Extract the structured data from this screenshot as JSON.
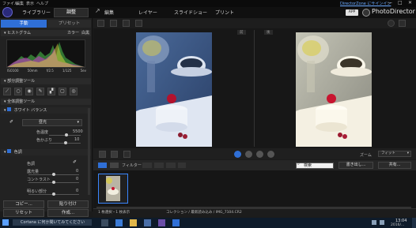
{
  "window": {
    "menus": [
      "ファイル",
      "編集",
      "表示",
      "ヘルプ"
    ],
    "signin_link": "DirectorZone にサインイン",
    "minimize": "—",
    "maximize": "□",
    "close": "✕"
  },
  "nav": {
    "items": [
      "ライブラリー",
      "調整",
      "編集",
      "レイヤー",
      "スライドショー",
      "プリント"
    ],
    "active": "調整",
    "app_badge": "APP",
    "brand": "PhotoDirector"
  },
  "left_panel": {
    "tabs": [
      "手動",
      "プリセット"
    ],
    "histogram": {
      "title": "ヒストグラム",
      "color_label": "カラー",
      "white_label": "白黒",
      "info": [
        "ISO100",
        "50mm",
        "f/2.5",
        "1/125",
        "5ev"
      ]
    },
    "section_partial": "部分調整ツール",
    "section_global": "全体調整ツール",
    "wb": {
      "title": "ホワイト バランス",
      "preset": "昼光",
      "temp_label": "色温度",
      "temp_value": "5500",
      "temp_pct": 0.55,
      "tint_label": "色かぶり",
      "tint_value": "10",
      "tint_pct": 0.52
    },
    "tone": {
      "title": "色調",
      "color_label": "色調",
      "exposure_label": "露光量",
      "contrast_label": "コントラスト",
      "highlight_label": "明るい部分",
      "exposure_value": "0",
      "contrast_value": "0",
      "highlight_value": "0",
      "exposure_pct": 0.5,
      "contrast_pct": 0.5,
      "highlight_pct": 0.5
    },
    "buttons": {
      "copy": "コピー...",
      "paste": "貼り付け",
      "reset": "リセット",
      "create": "作成..."
    }
  },
  "viewer": {
    "before_label": "前",
    "after_label": "後"
  },
  "control_bar": {
    "zoom_label": "ズーム",
    "zoom_value": "フィット"
  },
  "filter_bar": {
    "filter_label": "フィルター",
    "search_placeholder": "検索",
    "export_label": "書き出し...",
    "share_label": "共有..."
  },
  "status": {
    "left": "1 枚選択・1 枚表示",
    "path": "コレクション / 最新読み込み / IMG_7104.CR2"
  },
  "taskbar": {
    "search_placeholder": "Cortana に何か聞いてみてください",
    "time": "13:04",
    "date": "2016/..."
  },
  "colors": {
    "accent": "#2f6fd6",
    "link": "#6aa9ff",
    "taskbar": "#0e1b2a"
  }
}
